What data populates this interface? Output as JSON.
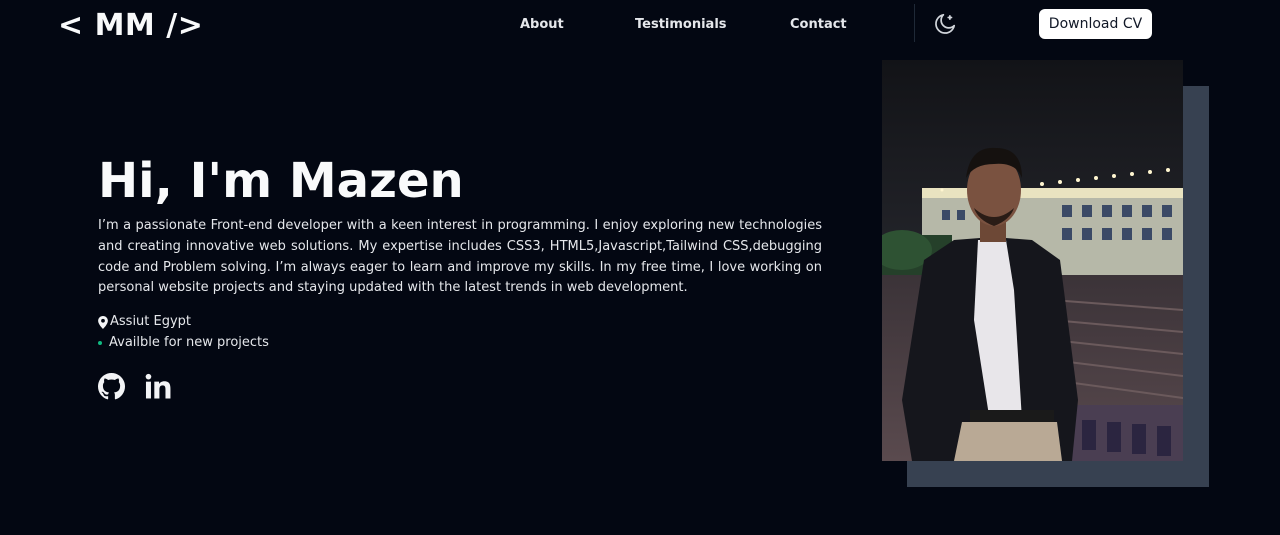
{
  "header": {
    "logo": "< MM />",
    "nav": [
      {
        "label": "About"
      },
      {
        "label": "Testimonials"
      },
      {
        "label": "Contact"
      }
    ],
    "theme_toggle_icon": "moon-icon",
    "download_label": "Download CV"
  },
  "hero": {
    "title": "Hi, I'm Mazen",
    "bio": "I’m a passionate Front-end developer with a keen interest in programming. I enjoy exploring new technologies and creating innovative web solutions. My expertise includes CSS3, HTML5,Javascript,Tailwind CSS,debugging code and Problem solving. I’m always eager to learn and improve my skills. In my free time, I love working on personal website projects and staying updated with the latest trends in web development.",
    "location": "Assiut Egypt",
    "location_icon": "map-pin-icon",
    "availability": "Availble for new projects",
    "availability_color": "#10b981",
    "social": [
      {
        "icon": "github-icon"
      },
      {
        "icon": "linkedin-icon"
      }
    ]
  },
  "profile_photo": {
    "shadow_color": "#374151"
  },
  "colors": {
    "background": "#030712",
    "text": "#f3f4f6",
    "button_bg": "#ffffff",
    "button_text": "#111827"
  }
}
